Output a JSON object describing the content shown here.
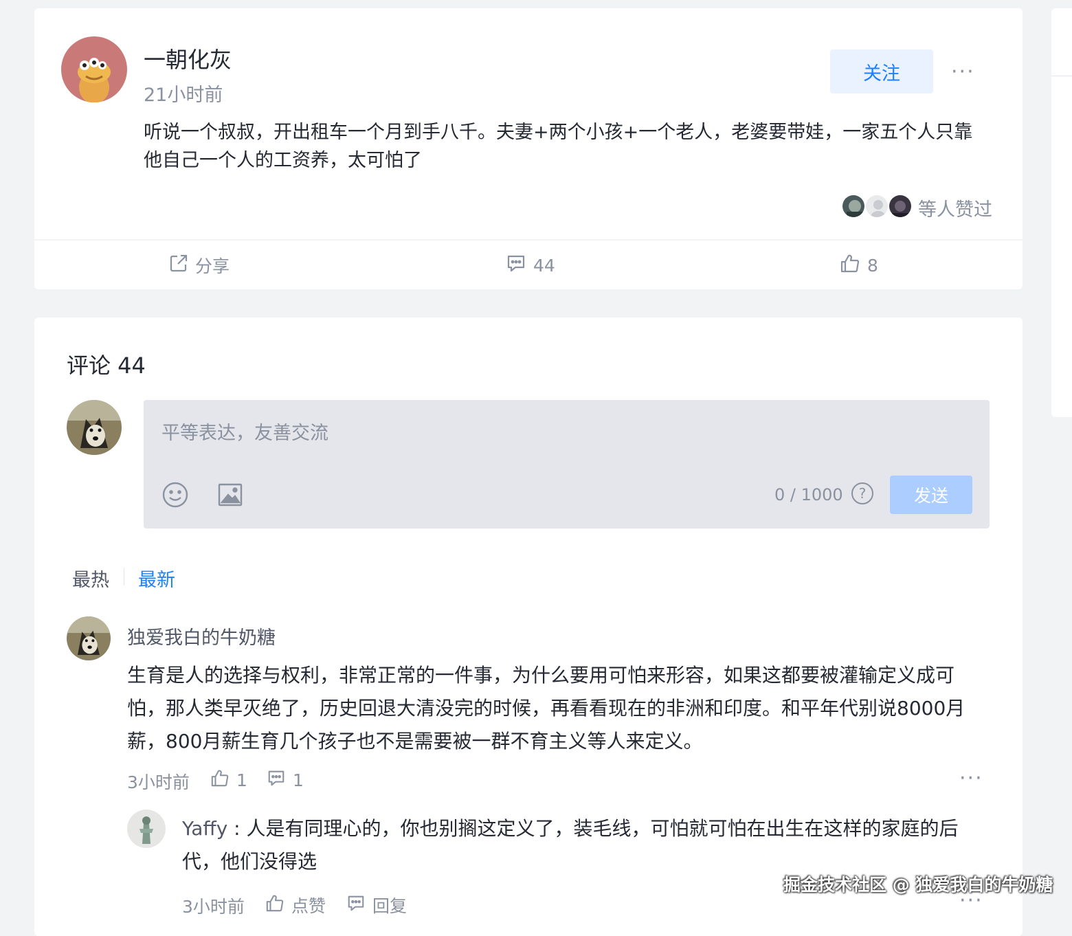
{
  "post": {
    "author": "一朝化灰",
    "time": "21小时前",
    "follow_label": "关注",
    "more_label": "···",
    "content": "听说一个叔叔，开出租车一个月到手八千。夫妻+两个小孩+一个老人，老婆要带娃，一家五个人只靠他自己一个人的工资养，太可怕了",
    "liked_by_text": "等人赞过",
    "actions": {
      "share_label": "分享",
      "comment_count": "44",
      "like_count": "8"
    }
  },
  "comments": {
    "title": "评论 44",
    "editor": {
      "placeholder": "平等表达，友善交流",
      "counter": "0 / 1000",
      "help_label": "?",
      "send_label": "发送"
    },
    "sort": {
      "hot": "最热",
      "new": "最新"
    },
    "items": [
      {
        "user": "独爱我白的牛奶糖",
        "content": "生育是人的选择与权利，非常正常的一件事，为什么要用可怕来形容，如果这都要被灌输定义成可怕，那人类早灭绝了，历史回退大清没完的时候，再看看现在的非洲和印度。和平年代别说8000月薪，800月薪生育几个孩子也不是需要被一群不育主义等人来定义。",
        "time": "3小时前",
        "likes": "1",
        "replies": "1",
        "more_label": "···",
        "reply": {
          "user": "Yaffy",
          "separator": " : ",
          "content": "人是有同理心的，你也别搁这定义了，装毛线，可怕就可怕在出生在这样的家庭的后代，他们没得选",
          "time": "3小时前",
          "like_label": "点赞",
          "reply_label": "回复",
          "more_label": "···"
        }
      }
    ]
  },
  "watermark": "掘金技术社区 @ 独爱我白的牛奶糖",
  "colors": {
    "accent": "#1e80ff",
    "muted": "#8a919f",
    "background": "#f2f3f5"
  }
}
